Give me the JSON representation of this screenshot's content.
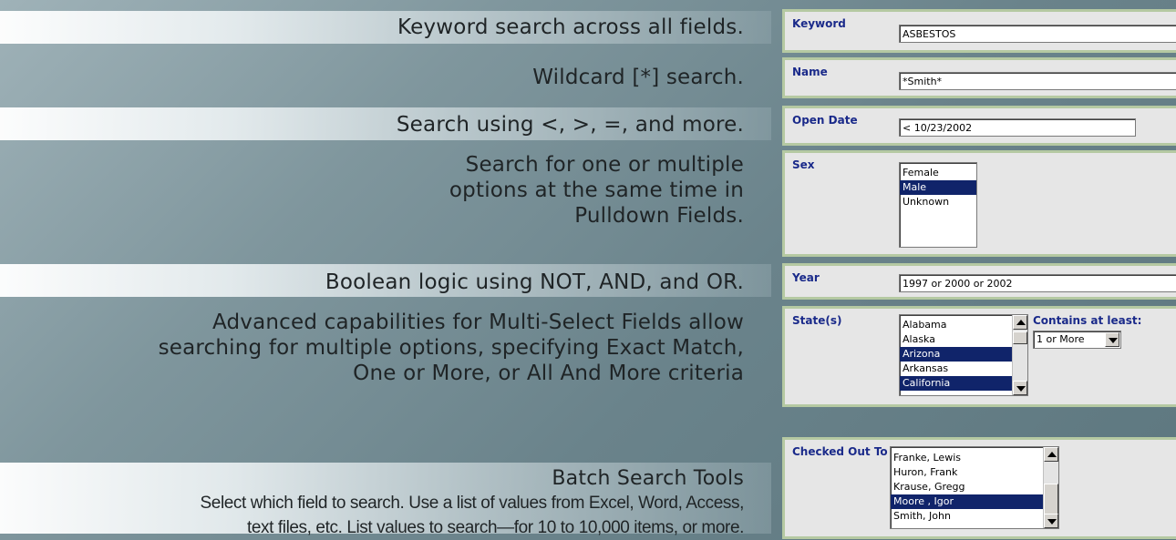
{
  "captions": {
    "keyword": "Keyword search across all fields.",
    "wildcard": "Wildcard [*] search.",
    "operators": "Search using <, >, =, and more.",
    "pulldown": [
      "Search for one or multiple",
      "options at the same time in",
      "Pulldown Fields."
    ],
    "boolean": "Boolean logic using NOT, AND, and OR.",
    "multiselect": [
      "Advanced capabilities for Multi-Select Fields allow",
      "searching for multiple options, specifying Exact Match,",
      "One or More, or All And More criteria"
    ],
    "batch_title": "Batch Search Tools",
    "batch_body": [
      "Select which field to search. Use a list of values from Excel, Word, Access,",
      "text files, etc. List values to search—for 10 to 10,000 items, or more."
    ]
  },
  "form": {
    "keyword": {
      "label": "Keyword",
      "value": "ASBESTOS"
    },
    "name": {
      "label": "Name",
      "value": "*Smith*"
    },
    "open_date": {
      "label": "Open Date",
      "value": "< 10/23/2002"
    },
    "sex": {
      "label": "Sex",
      "options": [
        "Female",
        "Male",
        "Unknown"
      ],
      "selected": "Male"
    },
    "year": {
      "label": "Year",
      "value": "1997 or 2000 or 2002"
    },
    "states": {
      "label": "State(s)",
      "options": [
        "Alabama",
        "Alaska",
        "Arizona",
        "Arkansas",
        "California"
      ],
      "selected": [
        "Arizona",
        "California"
      ],
      "contains_label": "Contains at least:",
      "contains_value": "1 or More"
    },
    "checked_out": {
      "label": "Checked Out To",
      "options": [
        "Franke, Lewis",
        "Huron, Frank",
        "Krause, Gregg",
        "Moore , Igor",
        "Smith, John"
      ],
      "selected": "Moore , Igor"
    }
  },
  "colors": {
    "label_blue": "#1a2a8a",
    "selection": "#10246a",
    "panel_border": "#b5c9a2",
    "panel_bg": "#e6e6e6"
  },
  "icons": [
    "scroll-up-arrow-icon",
    "scroll-down-arrow-icon",
    "dropdown-arrow-icon"
  ]
}
